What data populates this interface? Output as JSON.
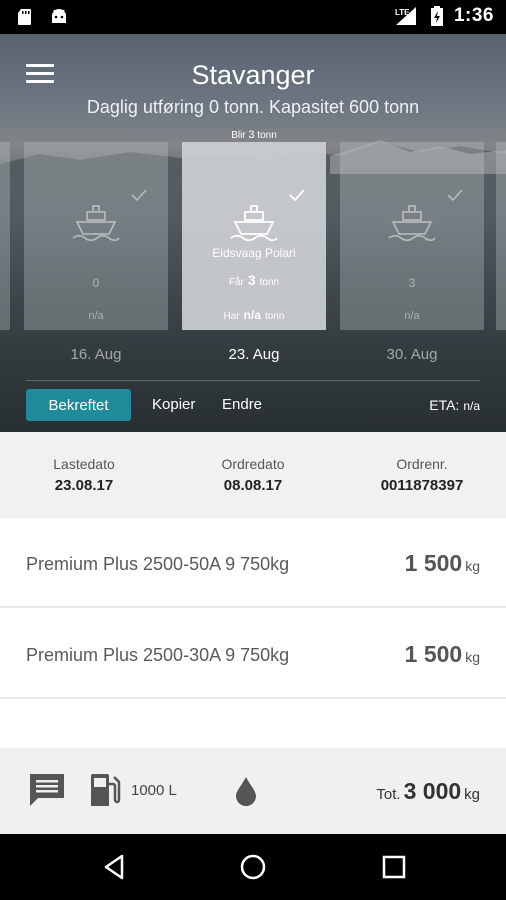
{
  "status_bar": {
    "time": "1:36",
    "network": "LTE"
  },
  "header": {
    "title": "Stavanger",
    "subtitle": "Daglig utføring 0 tonn. Kapasitet 600 tonn"
  },
  "selected_card_header": {
    "blir_label": "Blir",
    "blir_value": "3",
    "blir_unit": "tonn"
  },
  "cards": [
    {
      "value": "0",
      "har": "n/a",
      "date": "16. Aug"
    },
    {
      "ship_name": "Eidsvaag Polari",
      "faar_label": "Får",
      "faar_value": "3",
      "faar_unit": "tonn",
      "har_label": "Har",
      "har_value": "n/a",
      "har_unit": "tonn",
      "date": "23. Aug"
    },
    {
      "value": "3",
      "har": "n/a",
      "date": "30. Aug"
    }
  ],
  "actions": {
    "bekreftet": "Bekreftet",
    "kopier": "Kopier",
    "endre": "Endre",
    "eta_label": "ETA:",
    "eta_value": "n/a"
  },
  "info": {
    "lastedato_label": "Lastedato",
    "lastedato_value": "23.08.17",
    "ordredato_label": "Ordredato",
    "ordredato_value": "08.08.17",
    "ordrenr_label": "Ordrenr.",
    "ordrenr_value": "0011878397"
  },
  "products": [
    {
      "name": "Premium Plus 2500-50A 9 750kg",
      "qty": "1 500",
      "unit": "kg"
    },
    {
      "name": "Premium Plus 2500-30A 9 750kg",
      "qty": "1 500",
      "unit": "kg"
    }
  ],
  "bottom": {
    "fuel": "1000 L",
    "tot_label": "Tot.",
    "tot_value": "3 000",
    "tot_unit": "kg"
  },
  "colors": {
    "accent": "#1e8a9a"
  }
}
